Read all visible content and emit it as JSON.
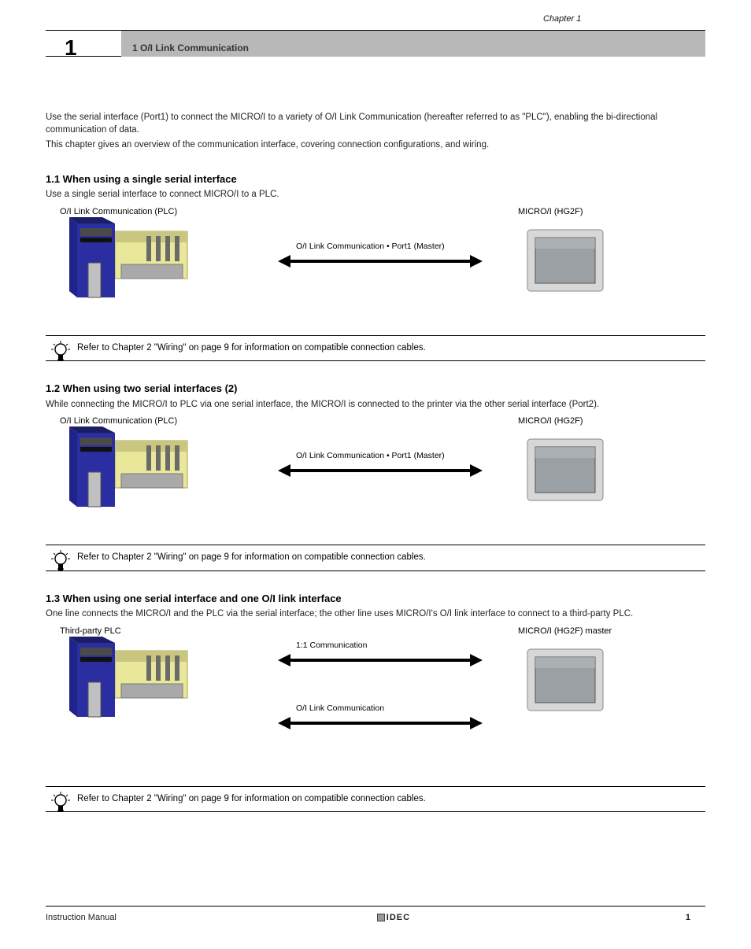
{
  "header": {
    "chapter_line": "Chapter 1",
    "chapter_num": "1",
    "banner_sub": "1 O/I Link Communication"
  },
  "intro": {
    "p1": "Use the serial interface (Port1) to connect the MICRO/I to a variety of O/I Link Communication (hereafter referred to as \"PLC\"), enabling the bi-directional communication of data.",
    "p2": "This chapter gives an overview of the communication interface, covering connection configurations, and wiring."
  },
  "sections": [
    {
      "title": "1.1 When using a single serial interface",
      "p": "Use a single serial interface to connect MICRO/I to a PLC.",
      "diag": {
        "plc_label": "O/I Link Communication (PLC)",
        "hmi_label": "MICRO/I (HG2F)",
        "arrows": [
          {
            "cap": "O/I Link Communication  •  Port1 (Master)"
          }
        ]
      },
      "hint": "Refer to Chapter 2 \"Wiring\" on page 9 for information on compatible connection cables."
    },
    {
      "title": "1.2 When using two serial interfaces (2)",
      "p": "While connecting the MICRO/I to PLC via one serial interface, the MICRO/I is connected to the printer via the other serial interface (Port2).",
      "diag": {
        "plc_label": "O/I Link Communication (PLC)",
        "hmi_label": "MICRO/I (HG2F)",
        "arrows": [
          {
            "cap": "O/I Link Communication  •  Port1 (Master)"
          }
        ]
      },
      "hint": "Refer to Chapter 2 \"Wiring\" on page 9 for information on compatible connection cables."
    },
    {
      "title": "1.3 When using one serial interface and one O/I link interface",
      "p": "One line connects the MICRO/I and the PLC via the serial interface; the other line uses MICRO/I's O/I link interface to connect to a third-party PLC.",
      "diag": {
        "plc_label": "Third-party PLC",
        "hmi_label": "MICRO/I (HG2F) master",
        "arrows": [
          {
            "cap": "1:1 Communication"
          },
          {
            "cap": "O/I Link Communication"
          }
        ]
      },
      "hint": "Refer to Chapter 2 \"Wiring\" on page 9 for information on compatible connection cables."
    }
  ],
  "footer": {
    "manual": "Instruction Manual",
    "page": "1"
  }
}
